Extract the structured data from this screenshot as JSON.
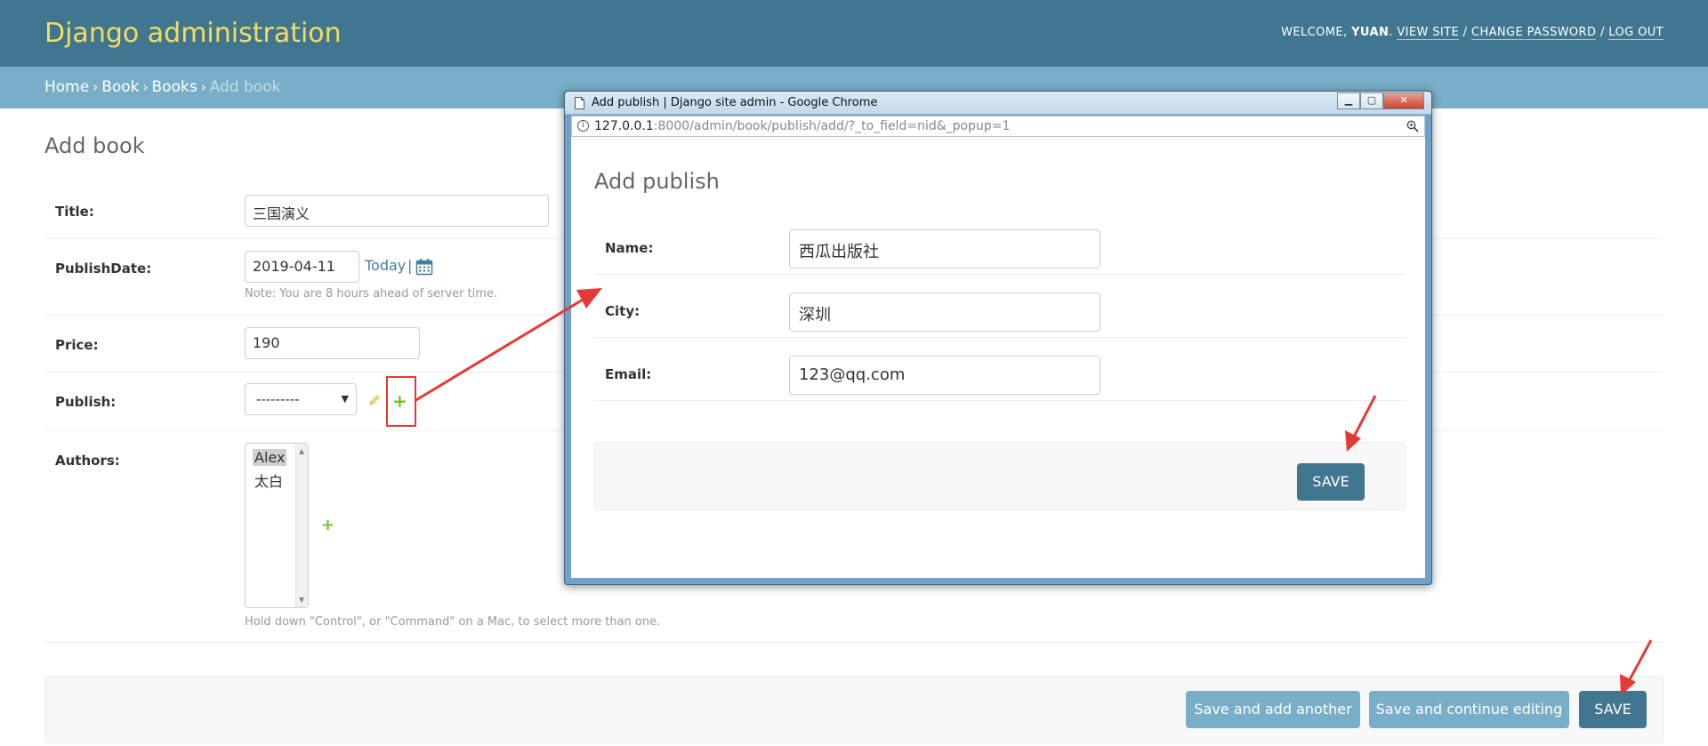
{
  "header": {
    "brand": "Django administration",
    "welcome": "WELCOME,",
    "user": "YUAN",
    "view_site": "VIEW SITE",
    "change_password": "CHANGE PASSWORD",
    "log_out": "LOG OUT",
    "separator": "/"
  },
  "breadcrumbs": {
    "home": "Home",
    "app": "Book",
    "model": "Books",
    "current": "Add book",
    "arrow": "›"
  },
  "form": {
    "title": "Add book",
    "fields": {
      "title": {
        "label": "Title:",
        "value": "三国演义"
      },
      "publish_date": {
        "label": "PublishDate:",
        "value": "2019-04-11",
        "today": "Today",
        "pipe": "|",
        "note": "Note: You are 8 hours ahead of server time."
      },
      "price": {
        "label": "Price:",
        "value": "190"
      },
      "publish": {
        "label": "Publish:",
        "selected": "---------",
        "add": "+"
      },
      "authors": {
        "label": "Authors:",
        "options": [
          "Alex",
          "太白"
        ],
        "help": "Hold down \"Control\", or \"Command\" on a Mac, to select more than one.",
        "add": "+"
      }
    },
    "buttons": {
      "save_add_another": "Save and add another",
      "save_continue": "Save and continue editing",
      "save": "SAVE"
    }
  },
  "popup": {
    "window_title": "Add publish | Django site admin - Google Chrome",
    "url_host": "127.0.0.1",
    "url_rest": ":8000/admin/book/publish/add/?_to_field=nid&_popup=1",
    "info": "i",
    "heading": "Add publish",
    "fields": {
      "name": {
        "label": "Name:",
        "value": "西瓜出版社"
      },
      "city": {
        "label": "City:",
        "value": "深圳"
      },
      "email": {
        "label": "Email:",
        "value": "123@qq.com"
      }
    },
    "save": "SAVE"
  },
  "colors": {
    "header_bg": "#417690",
    "brand": "#f5dd5d",
    "breadcrumbs_bg": "#79aec8",
    "link": "#447e9b",
    "add_green": "#70bf2b",
    "annotation_red": "#e53935"
  }
}
